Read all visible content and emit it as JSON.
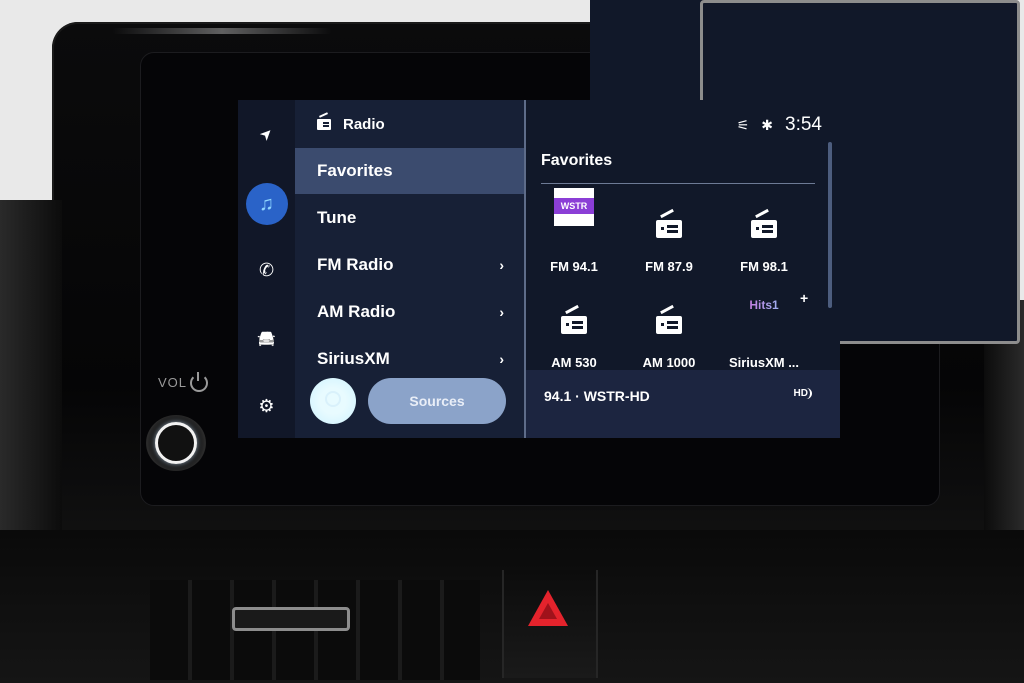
{
  "hardware": {
    "vol_label": "VOL"
  },
  "rail": {
    "items": [
      {
        "name": "navigation",
        "glyph": "➤"
      },
      {
        "name": "media",
        "glyph": "♫"
      },
      {
        "name": "phone",
        "glyph": "✆"
      },
      {
        "name": "vehicle",
        "glyph": "🚘"
      },
      {
        "name": "settings",
        "glyph": "⚙"
      }
    ]
  },
  "menu": {
    "header": "Radio",
    "items": [
      {
        "label": "Favorites",
        "selected": true,
        "chevron": false
      },
      {
        "label": "Tune",
        "selected": false,
        "chevron": false
      },
      {
        "label": "FM Radio",
        "selected": false,
        "chevron": true
      },
      {
        "label": "AM Radio",
        "selected": false,
        "chevron": true
      },
      {
        "label": "SiriusXM",
        "selected": false,
        "chevron": true
      }
    ],
    "chevron_glyph": "›",
    "sources_label": "Sources"
  },
  "status": {
    "time": "3:54",
    "bluetooth_glyph": "✱",
    "mute_glyph": "⚟"
  },
  "favorites": {
    "title": "Favorites",
    "add_glyph": "+",
    "tiles": [
      {
        "label": "FM 94.1",
        "icon": "station-logo",
        "logo_text": "WSTR"
      },
      {
        "label": "FM 87.9",
        "icon": "radio"
      },
      {
        "label": "FM 98.1",
        "icon": "radio"
      },
      {
        "label": "AM 530",
        "icon": "radio"
      },
      {
        "label": "AM 1000",
        "icon": "radio"
      },
      {
        "label": "SiriusXM ...",
        "icon": "sirius-logo",
        "logo_text": "Hits1"
      }
    ]
  },
  "now_playing": {
    "station": "94.1 · WSTR-HD",
    "hd_badge": "HD"
  },
  "colors": {
    "accent": "#2a63c8",
    "selected_row": "#3b4b6e",
    "sources_button": "#8ba3c9",
    "hazard": "#e4232c"
  }
}
